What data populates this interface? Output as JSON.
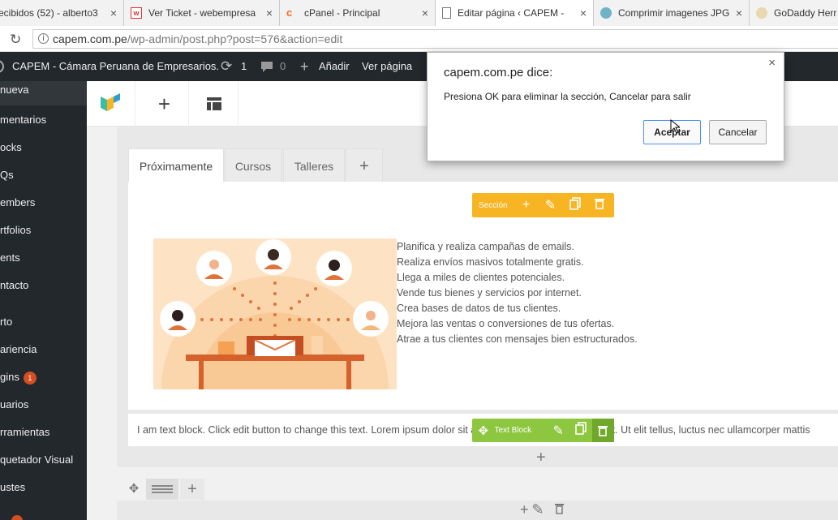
{
  "browser": {
    "tabs": [
      {
        "title": "ecibidos (52) - alberto3",
        "close": "×"
      },
      {
        "title": "Ver Ticket - webempresa",
        "close": "×"
      },
      {
        "title": "cPanel - Principal",
        "close": "×"
      },
      {
        "title": "Editar página ‹ CAPEM - ",
        "close": "×"
      },
      {
        "title": "Comprimir imagenes JPG",
        "close": "×"
      },
      {
        "title": "GoDaddy Herr",
        "close": ""
      }
    ],
    "url_host": "capem.com.pe",
    "url_path": "/wp-admin/post.php?post=576&action=edit",
    "reload_icon": "↻",
    "info_icon": "i"
  },
  "adminbar": {
    "site_name": "CAPEM - Cámara Peruana de Empresarios.",
    "updates_count": "1",
    "comments_count": "0",
    "add_new": "Añadir",
    "view_page": "Ver página"
  },
  "sidebar": {
    "items": [
      {
        "label": "nueva"
      },
      {
        "label": "mentarios"
      },
      {
        "label": "ocks"
      },
      {
        "label": "Qs"
      },
      {
        "label": "embers"
      },
      {
        "label": "rtfolios"
      },
      {
        "label": "ents"
      },
      {
        "label": "ntacto"
      },
      {
        "label": "rto"
      },
      {
        "label": "ariencia"
      },
      {
        "label": "gins"
      },
      {
        "label": "uarios"
      },
      {
        "label": "rramientas"
      },
      {
        "label": "quetador Visual"
      },
      {
        "label": "ustes"
      }
    ],
    "plugins_badge": "1"
  },
  "vc": {
    "tabs": [
      {
        "label": "Próximamente"
      },
      {
        "label": "Cursos"
      },
      {
        "label": "Talleres"
      },
      {
        "label": "+"
      }
    ],
    "section_label": "Sección",
    "textblock_label": "Text Block",
    "features": [
      "Planifica y realiza campañas de emails.",
      "Realiza envíos masivos totalmente gratis.",
      "Llega a miles de clientes potenciales.",
      "Vende tus bienes y servicios por internet.",
      "Crea bases de datos de tus clientes.",
      "Mejora las ventas o conversiones de tus ofertas.",
      "Atrae a tus clientes con mensajes bien estructurados."
    ],
    "text_block": "I am text block. Click edit button to change this text. Lorem ipsum dolor sit amet, consectetur adipiscing elit. Ut elit tellus, luctus nec ullamcorper mattis"
  },
  "dialog": {
    "title": "capem.com.pe dice:",
    "message": "Presiona OK para eliminar la sección, Cancelar para salir",
    "ok": "Aceptar",
    "cancel": "Cancelar",
    "close": "×"
  },
  "colors": {
    "section_toolbar": "#f7b523",
    "textblock_toolbar": "#8dc63f",
    "admin_bg": "#23282d"
  }
}
